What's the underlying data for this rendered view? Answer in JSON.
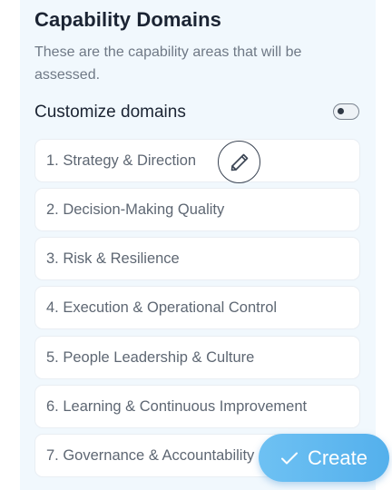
{
  "section": {
    "title": "Capability Domains",
    "subtitle": "These are the capability areas that will be assessed."
  },
  "customize": {
    "label": "Customize domains",
    "toggle_on": false
  },
  "domains": [
    "1. Strategy & Direction",
    "2. Decision-Making Quality",
    "3. Risk & Resilience",
    "4. Execution & Operational Control",
    "5. People Leadership & Culture",
    "6. Learning & Continuous Improvement",
    "7. Governance & Accountability"
  ],
  "create_button": {
    "label": "Create",
    "icon": "check-icon"
  },
  "edit_button": {
    "icon": "pencil-icon"
  },
  "colors": {
    "accent": "#5ab4ee",
    "panel_bg": "#f1f8fd",
    "title_text": "#1b2433",
    "muted_text": "#6f7986"
  }
}
